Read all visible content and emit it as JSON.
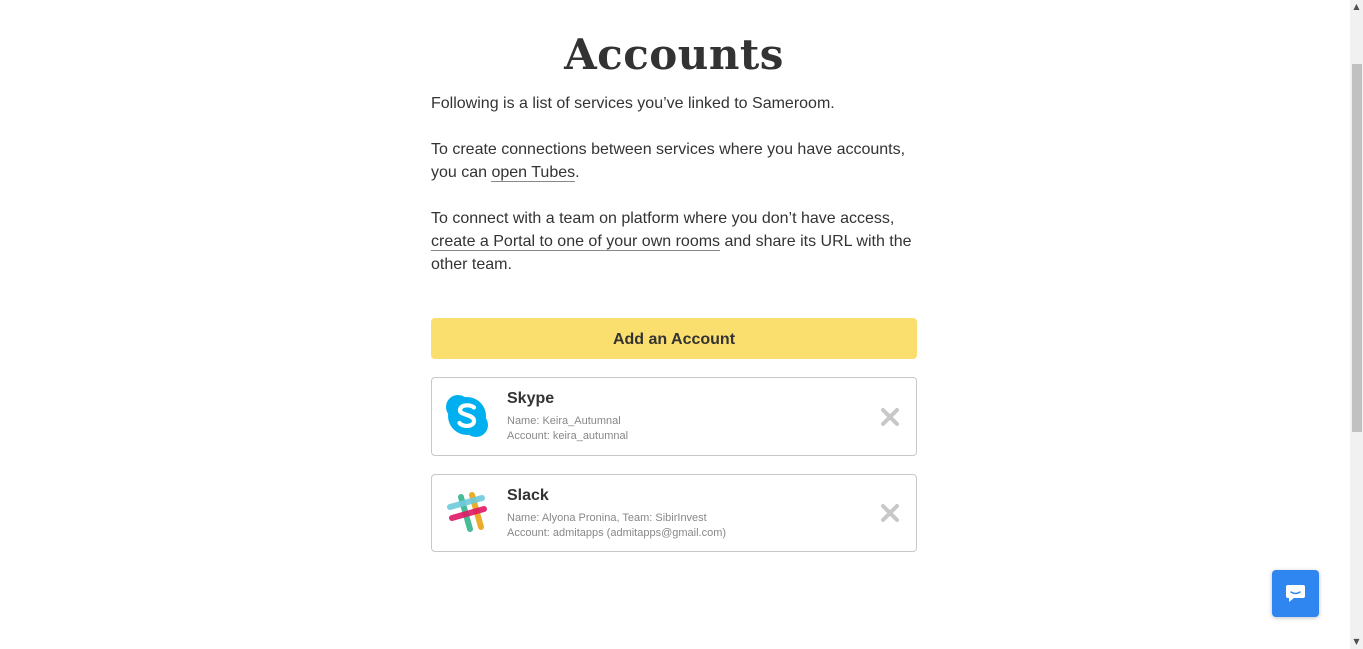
{
  "page": {
    "title": "Accounts",
    "intro_line1": "Following is a list of services you’ve linked to Sameroom.",
    "para2_before": "To create connections between services where you have accounts, you can ",
    "para2_link": "open Tubes",
    "para2_after": ".",
    "para3_before": "To connect with a team on platform where you don’t have access, ",
    "para3_link": "create a Portal to one of your own rooms",
    "para3_after": " and share its URL with the other team."
  },
  "add_account_button": "Add an Account",
  "accounts": [
    {
      "service": "Skype",
      "icon": "skype-logo-icon",
      "name_line": "Name: Keira_Autumnal",
      "account_line": "Account: keira_autumnal"
    },
    {
      "service": "Slack",
      "icon": "slack-logo-icon",
      "name_line": "Name: Alyona Pronina, Team: SibirInvest",
      "account_line": "Account: admitapps (admitapps@gmail.com)"
    }
  ],
  "colors": {
    "add_button_bg": "#fadf6f",
    "skype_blue": "#00aff0",
    "chat_button_bg": "#2f86f0",
    "remove_x": "#c8c8c8"
  }
}
